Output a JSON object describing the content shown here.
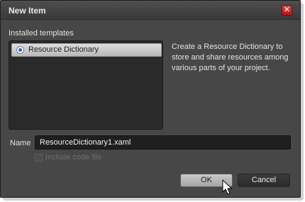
{
  "dialog": {
    "title": "New Item",
    "close_glyph": "✕"
  },
  "templates": {
    "label": "Installed templates",
    "items": [
      {
        "label": "Resource Dictionary",
        "icon": "resource-dictionary-icon",
        "selected": true
      }
    ],
    "description": "Create a Resource Dictionary to store and share resources among various parts of your project."
  },
  "name": {
    "label": "Name",
    "value": "ResourceDictionary1.xaml"
  },
  "include_code": {
    "label": "Include code file",
    "checked": false,
    "enabled": false
  },
  "buttons": {
    "ok": "OK",
    "cancel": "Cancel"
  },
  "colors": {
    "dialog_bg": "#474747",
    "list_bg": "#2a2a2a",
    "close_red": "#c82222"
  }
}
